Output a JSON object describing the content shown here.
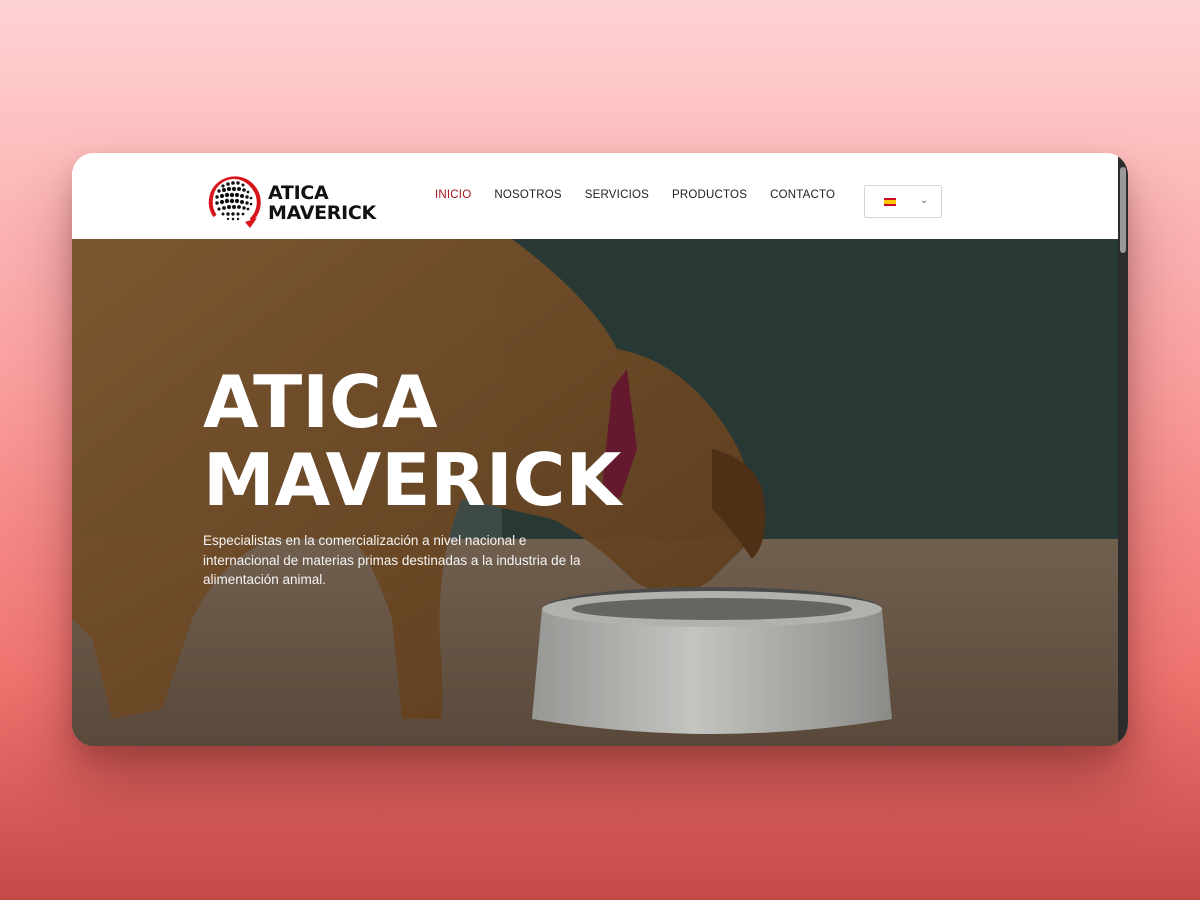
{
  "brand": {
    "logo_line1": "ATICA",
    "logo_line2": "MAVERICK",
    "logo_colors": {
      "red": "#d7141a",
      "dark": "#111111"
    }
  },
  "nav": {
    "items": [
      {
        "label": "INICIO",
        "active": true
      },
      {
        "label": "NOSOTROS",
        "active": false
      },
      {
        "label": "SERVICIOS",
        "active": false
      },
      {
        "label": "PRODUCTOS",
        "active": false
      },
      {
        "label": "CONTACTO",
        "active": false
      }
    ],
    "active_color": "#a3151d"
  },
  "language_selector": {
    "selected": "spain-flag-icon",
    "dropdown_icon": "chevron-down-icon"
  },
  "hero": {
    "title_line1": "ATICA",
    "title_line2": "MAVERICK",
    "description": "Especialistas en la comercialización a nivel nacional e internacional de materias primas destinadas a la industria de la alimentación animal.",
    "image": "dog-eating-from-bowl"
  },
  "background": {
    "gradient_top": "#ffd3d3",
    "gradient_bottom": "#c44a48"
  }
}
